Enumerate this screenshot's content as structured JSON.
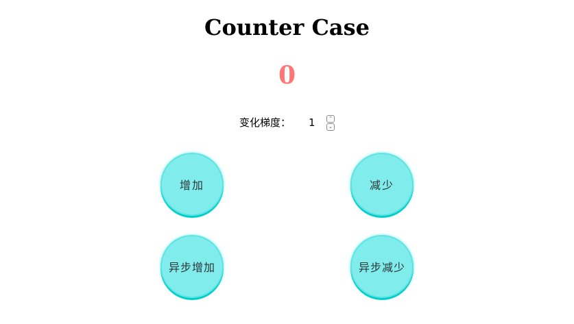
{
  "app": {
    "title": "Counter Case"
  },
  "counter": {
    "value": "0",
    "color": "#ff7675"
  },
  "step": {
    "label": "变化梯度：",
    "value": "1",
    "up_icon": "chevron-up-icon",
    "down_icon": "chevron-down-icon"
  },
  "buttons": {
    "increment_label": "增加",
    "decrement_label": "减少",
    "async_increment_label": "异步增加",
    "async_decrement_label": "异步减少",
    "fill_color": "#81ecec",
    "shadow_color": "#00cec9",
    "text_color": "#2d3436"
  }
}
